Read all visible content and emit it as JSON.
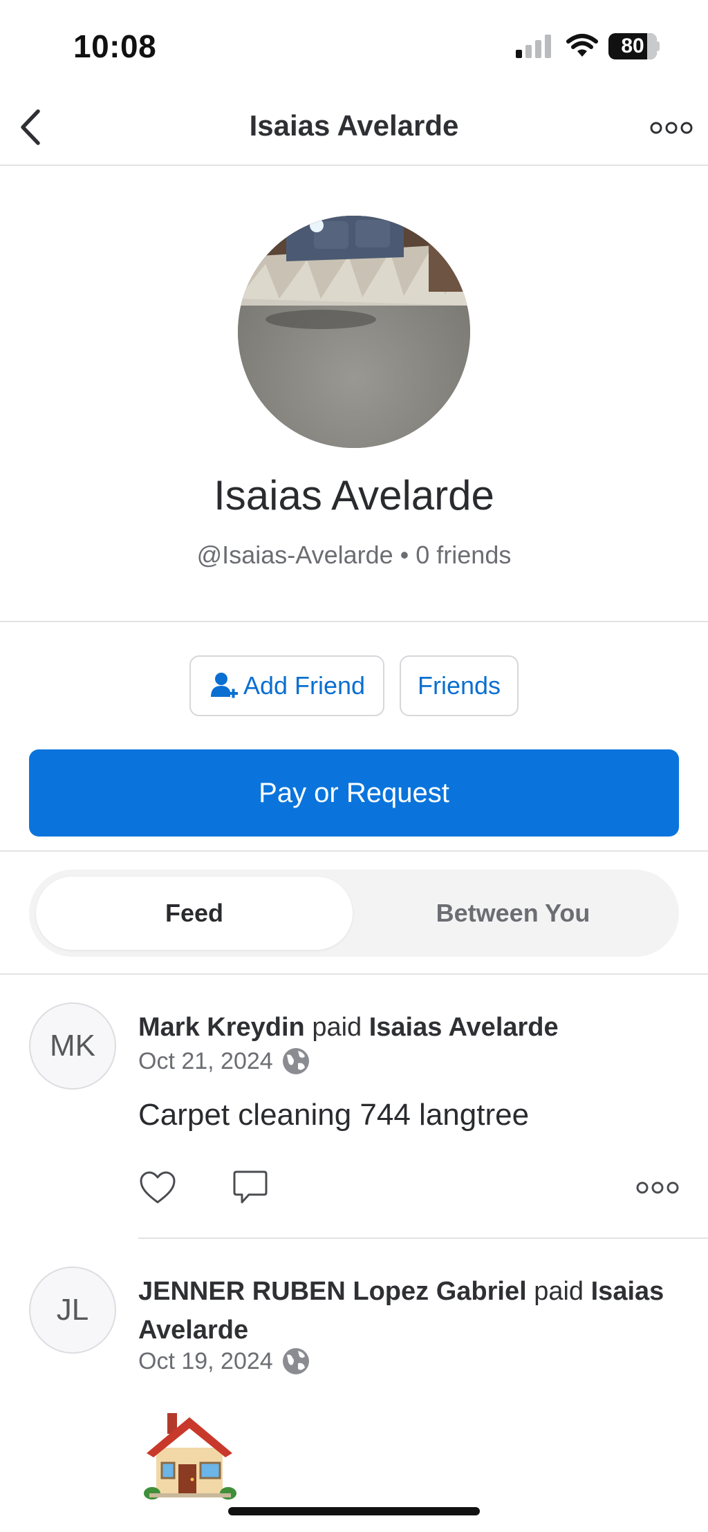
{
  "status_bar": {
    "time": "10:08",
    "battery": "80"
  },
  "nav": {
    "title": "Isaias Avelarde",
    "back_icon": "chevron-left-icon",
    "more_icon": "ellipsis-icon"
  },
  "profile": {
    "name": "Isaias Avelarde",
    "username": "@Isaias-Avelarde",
    "separator": "•",
    "friends": "0 friends"
  },
  "actions": {
    "add_friend_label": "Add Friend",
    "friends_label": "Friends",
    "pay_label": "Pay or Request"
  },
  "tabs": [
    {
      "label": "Feed",
      "active": true
    },
    {
      "label": "Between You",
      "active": false
    }
  ],
  "feed": [
    {
      "initials": "MK",
      "actor": "Mark Kreydin",
      "verb": "paid",
      "target": "Isaias Avelarde",
      "date": "Oct 21, 2024",
      "note": "Carpet cleaning 744 langtree"
    },
    {
      "initials": "JL",
      "actor": "JENNER RUBEN Lopez Gabriel",
      "verb": "paid",
      "target": "Isaias Avelarde",
      "date": "Oct 19, 2024",
      "note": "house-emoji"
    }
  ],
  "colors": {
    "accent": "#0a74dc",
    "link": "#0a6fd1",
    "text": "#2f3033",
    "muted": "#6b6d72",
    "divider": "#e3e3e6"
  }
}
